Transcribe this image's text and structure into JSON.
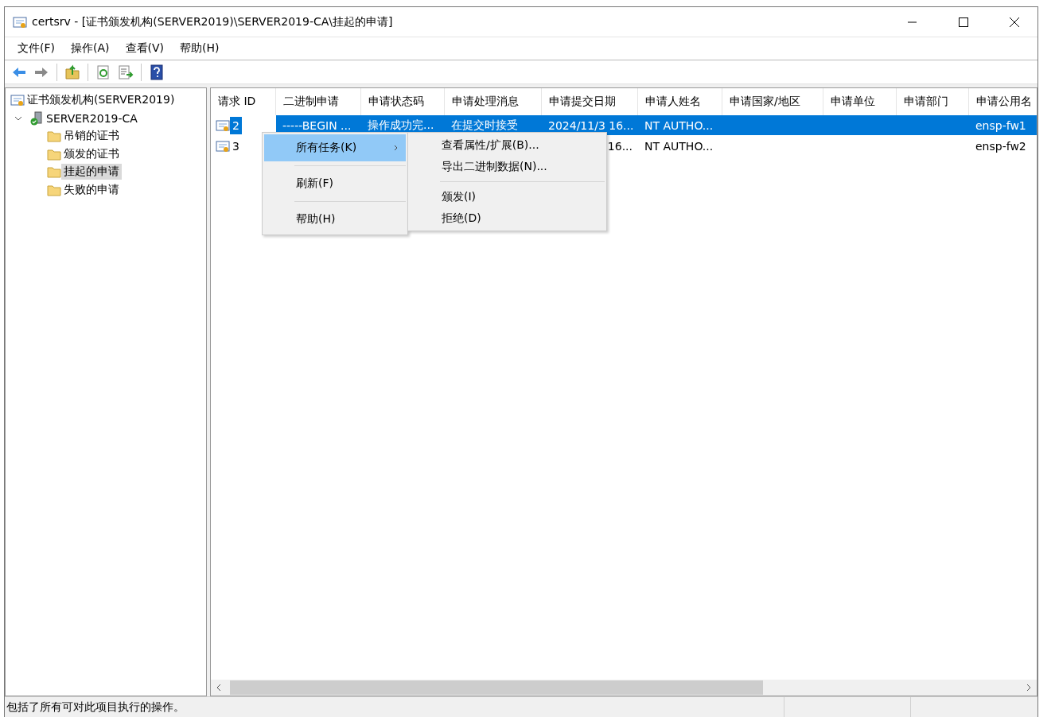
{
  "window": {
    "title": "certsrv - [证书颁发机构(SERVER2019)\\SERVER2019-CA\\挂起的申请]"
  },
  "menu_bar": [
    "文件(F)",
    "操作(A)",
    "查看(V)",
    "帮助(H)"
  ],
  "tree": [
    {
      "label": "证书颁发机构(SERVER2019)",
      "kind": "root",
      "selected": false,
      "children": [
        {
          "label": "SERVER2019-CA",
          "kind": "ca",
          "selected": false,
          "expanded": true,
          "children": [
            {
              "label": "吊销的证书",
              "kind": "folder",
              "selected": false
            },
            {
              "label": "颁发的证书",
              "kind": "folder",
              "selected": false
            },
            {
              "label": "挂起的申请",
              "kind": "folder",
              "selected": true
            },
            {
              "label": "失败的申请",
              "kind": "folder",
              "selected": false
            }
          ]
        }
      ]
    }
  ],
  "table": {
    "columns": [
      "请求 ID",
      "二进制申请",
      "申请状态码",
      "申请处理消息",
      "申请提交日期",
      "申请人姓名",
      "申请国家/地区",
      "申请单位",
      "申请部门",
      "申请公用名"
    ],
    "rows": [
      {
        "selected": true,
        "cells": [
          {
            "text": "2"
          },
          {
            "text": "-----BEGIN ..."
          },
          {
            "text": "操作成功完..."
          },
          {
            "text": "在提交时接受"
          },
          {
            "text": "2024/11/3 16..."
          },
          {
            "text": "NT AUTHO..."
          },
          null,
          null,
          null,
          {
            "text": "ensp-fw1"
          }
        ]
      },
      {
        "selected": false,
        "cells": [
          {
            "text": "3"
          },
          null,
          null,
          null,
          {
            "text": "16...",
            "partial": true
          },
          {
            "text": "NT AUTHO..."
          },
          null,
          null,
          null,
          {
            "text": "ensp-fw2"
          }
        ]
      }
    ]
  },
  "context_menu": {
    "items": [
      {
        "kind": "submenu",
        "label": "所有任务(K)",
        "selected": true
      },
      {
        "kind": "separator"
      },
      {
        "kind": "item",
        "label": "刷新(F)",
        "selected": false
      },
      {
        "kind": "separator"
      },
      {
        "kind": "item",
        "label": "帮助(H)",
        "selected": false
      }
    ],
    "submenu": [
      {
        "kind": "item",
        "label": "查看属性/扩展(B)...",
        "selected": false
      },
      {
        "kind": "item",
        "label": "导出二进制数据(N)...",
        "selected": false
      },
      {
        "kind": "separator"
      },
      {
        "kind": "item",
        "label": "颁发(I)",
        "selected": false
      },
      {
        "kind": "item",
        "label": "拒绝(D)",
        "selected": false
      }
    ]
  },
  "status_bar": {
    "text": "包括了所有可对此项目执行的操作。"
  }
}
